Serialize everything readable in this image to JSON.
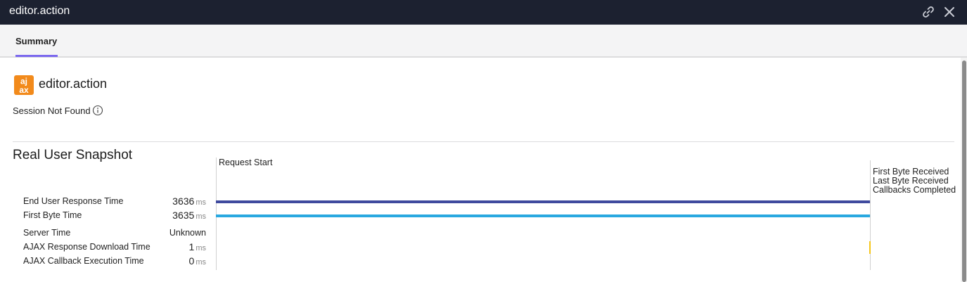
{
  "window": {
    "title": "editor.action",
    "link_icon": "link-icon",
    "close_icon": "close-icon"
  },
  "tabs": [
    {
      "label": "Summary",
      "active": true
    }
  ],
  "header": {
    "logo_icon": "ajax-logo-icon",
    "logo_color": "#f28a1b",
    "title": "editor.action",
    "session_status": "Session Not Found",
    "info_icon": "info-icon"
  },
  "snapshot": {
    "title": "Real User Snapshot",
    "metrics": [
      {
        "label": "End User Response Time",
        "value": "3636",
        "unit": "ms"
      },
      {
        "label": "First Byte Time",
        "value": "3635",
        "unit": "ms"
      },
      {
        "label": "Server Time",
        "value": "Unknown",
        "unit": ""
      },
      {
        "label": "AJAX Response Download Time",
        "value": "1",
        "unit": "ms"
      },
      {
        "label": "AJAX Callback Execution Time",
        "value": "0",
        "unit": "ms"
      }
    ],
    "timeline": {
      "start_label": "Request Start",
      "end_labels": [
        "First Byte Received",
        "Last Byte Received",
        "Callbacks Completed"
      ],
      "colors": {
        "end_user_bar": "#3f4a9e",
        "first_byte_bar": "#29a8e0",
        "download_bar": "#f5c518",
        "accent_tab": "#7b68ee"
      }
    }
  }
}
